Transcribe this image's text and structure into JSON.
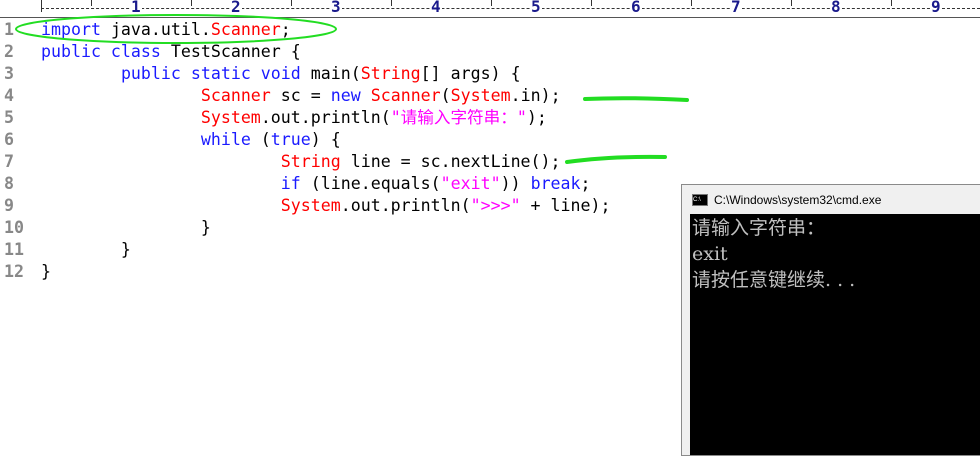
{
  "ruler": {
    "numbers": [
      "1",
      "2",
      "3",
      "4",
      "5",
      "6",
      "7",
      "8",
      "9"
    ]
  },
  "code": [
    {
      "n": "1",
      "tokens": [
        [
          "kw",
          "import"
        ],
        [
          "df",
          " java.util."
        ],
        [
          "ty",
          "Scanner"
        ],
        [
          "df",
          ";"
        ]
      ]
    },
    {
      "n": "2",
      "tokens": [
        [
          "kw",
          "public class"
        ],
        [
          "df",
          " TestScanner {"
        ]
      ]
    },
    {
      "n": "3",
      "tokens": [
        [
          "df",
          "        "
        ],
        [
          "kw",
          "public static void"
        ],
        [
          "df",
          " main("
        ],
        [
          "ty",
          "String"
        ],
        [
          "df",
          "[] args) {"
        ]
      ]
    },
    {
      "n": "4",
      "tokens": [
        [
          "df",
          "                "
        ],
        [
          "ty",
          "Scanner"
        ],
        [
          "df",
          " sc = "
        ],
        [
          "kw",
          "new"
        ],
        [
          "df",
          " "
        ],
        [
          "ty",
          "Scanner"
        ],
        [
          "df",
          "("
        ],
        [
          "ty",
          "System"
        ],
        [
          "df",
          ".in);"
        ]
      ]
    },
    {
      "n": "5",
      "tokens": [
        [
          "df",
          "                "
        ],
        [
          "ty",
          "System"
        ],
        [
          "df",
          ".out.println("
        ],
        [
          "st",
          "\"请输入字符串：\""
        ],
        [
          "df",
          ");"
        ]
      ]
    },
    {
      "n": "6",
      "tokens": [
        [
          "df",
          "                "
        ],
        [
          "kw",
          "while"
        ],
        [
          "df",
          " ("
        ],
        [
          "kw",
          "true"
        ],
        [
          "df",
          ") {"
        ]
      ]
    },
    {
      "n": "7",
      "tokens": [
        [
          "df",
          "                        "
        ],
        [
          "ty",
          "String"
        ],
        [
          "df",
          " line = sc.nextLine();"
        ]
      ]
    },
    {
      "n": "8",
      "tokens": [
        [
          "df",
          "                        "
        ],
        [
          "kw",
          "if"
        ],
        [
          "df",
          " (line.equals("
        ],
        [
          "st",
          "\"exit\""
        ],
        [
          "df",
          ")) "
        ],
        [
          "kw",
          "break"
        ],
        [
          "df",
          ";"
        ]
      ]
    },
    {
      "n": "9",
      "tokens": [
        [
          "df",
          "                        "
        ],
        [
          "ty",
          "System"
        ],
        [
          "df",
          ".out.println("
        ],
        [
          "st",
          "\">>>\""
        ],
        [
          "df",
          " + line);"
        ]
      ]
    },
    {
      "n": "10",
      "tokens": [
        [
          "df",
          "                }"
        ]
      ]
    },
    {
      "n": "11",
      "tokens": [
        [
          "df",
          "        }"
        ]
      ]
    },
    {
      "n": "12",
      "tokens": [
        [
          "df",
          "}"
        ]
      ]
    }
  ],
  "cmd": {
    "title": "C:\\Windows\\system32\\cmd.exe",
    "icon": "cmd-icon",
    "lines": [
      "请输入字符串：",
      "exit",
      "请按任意键继续. . ."
    ]
  },
  "colors": {
    "keyword": "#1a1aff",
    "type": "#ff0000",
    "string": "#ff00ff",
    "annotation": "#22dd22"
  }
}
